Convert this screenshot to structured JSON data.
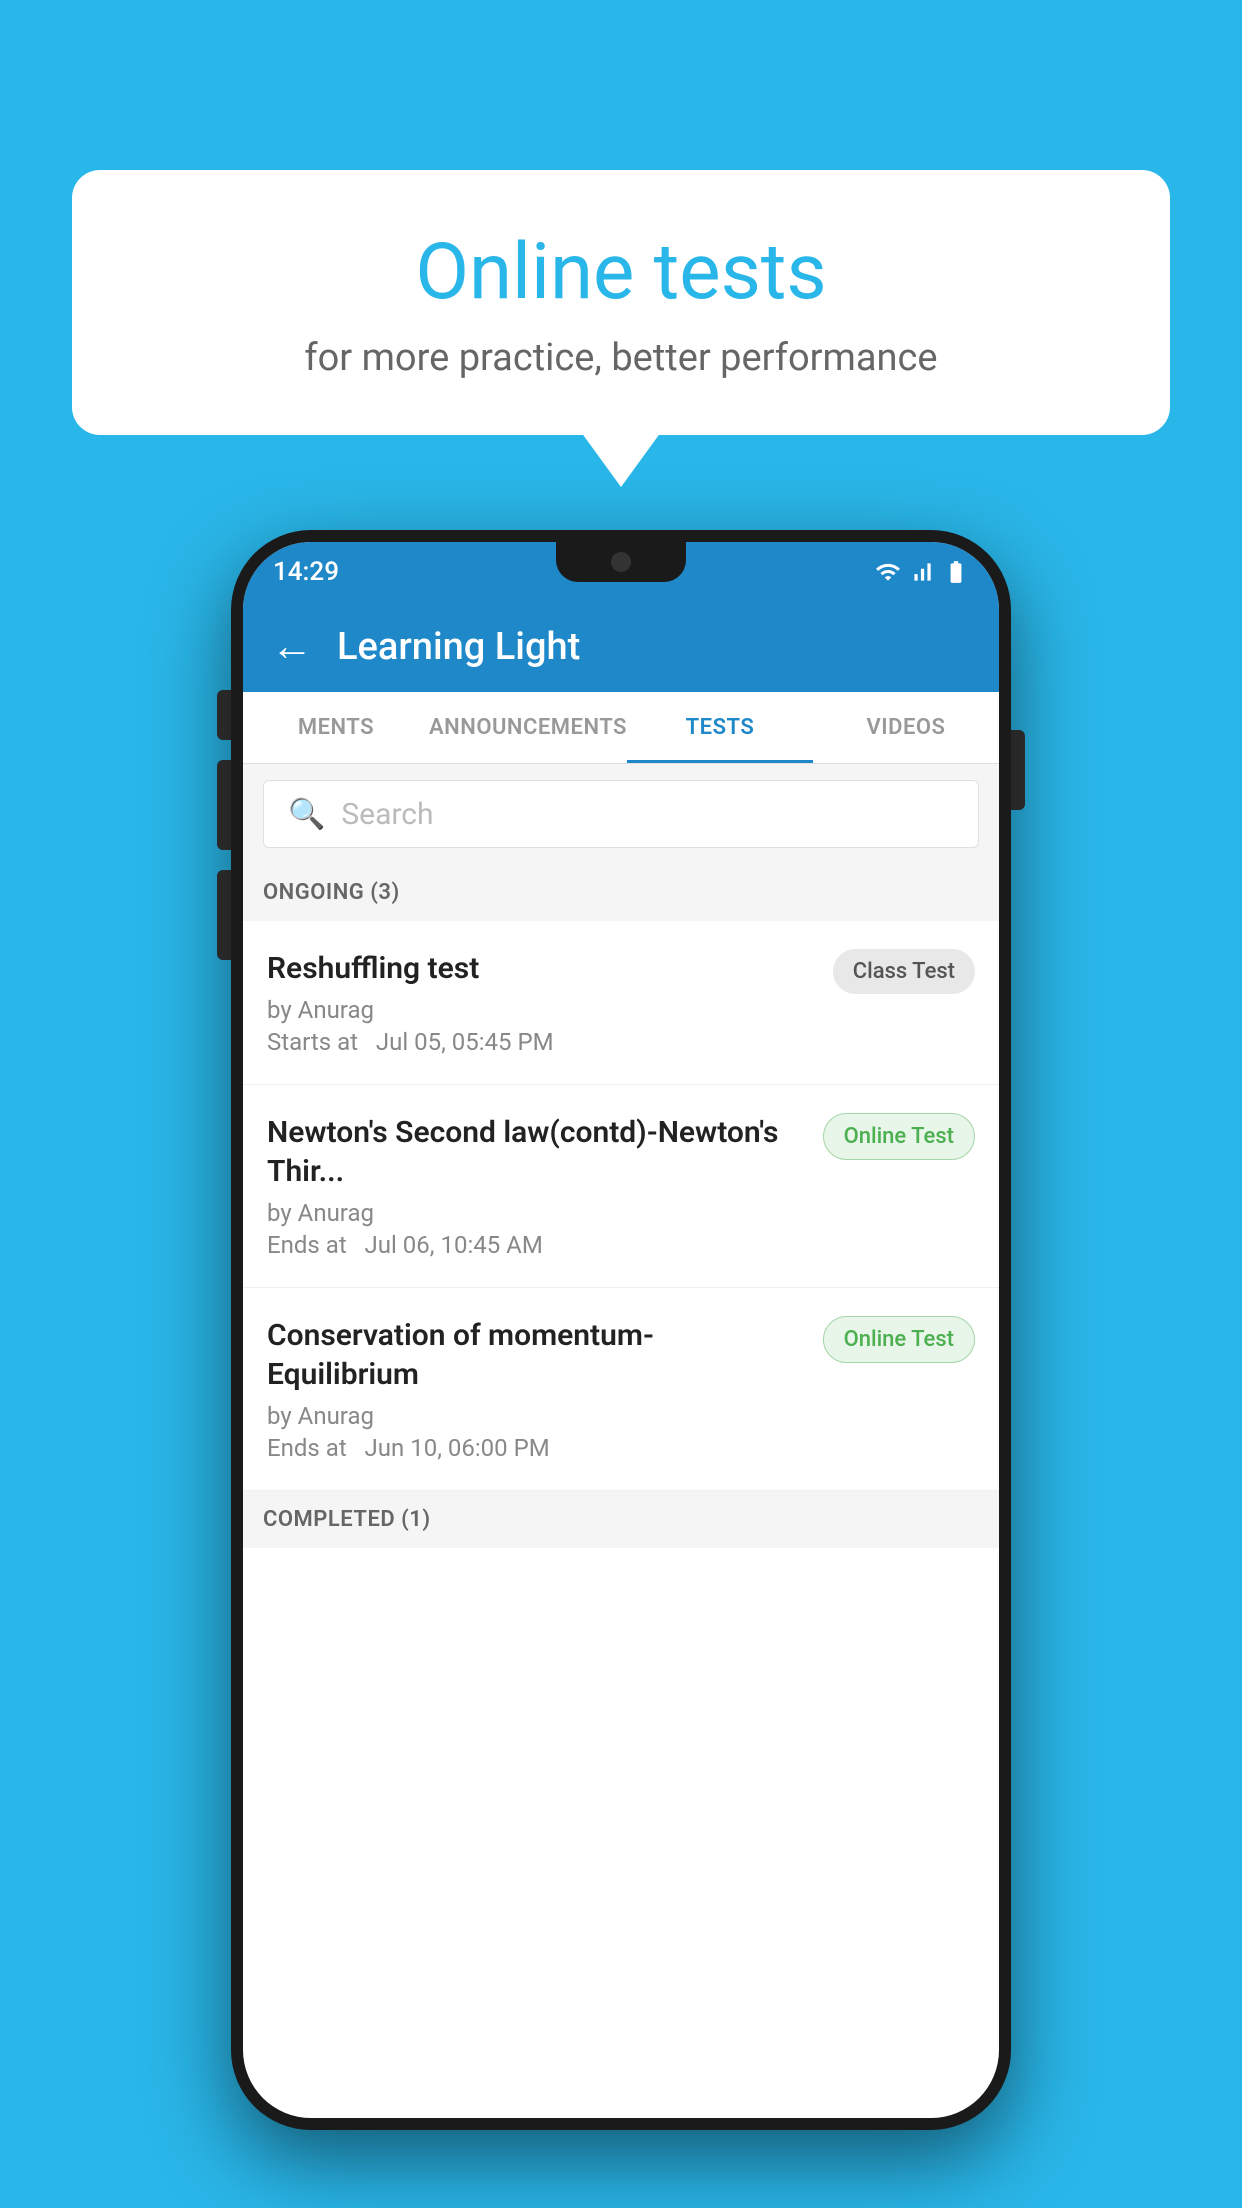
{
  "background_color": "#29b6e8",
  "speech_bubble": {
    "title": "Online tests",
    "subtitle": "for more practice, better performance"
  },
  "status_bar": {
    "time": "14:29"
  },
  "app_bar": {
    "back_icon": "←",
    "title": "Learning Light"
  },
  "tabs": [
    {
      "label": "MENTS",
      "active": false
    },
    {
      "label": "ANNOUNCEMENTS",
      "active": false
    },
    {
      "label": "TESTS",
      "active": true
    },
    {
      "label": "VIDEOS",
      "active": false
    }
  ],
  "search": {
    "placeholder": "Search"
  },
  "ongoing_section": {
    "label": "ONGOING (3)"
  },
  "tests": [
    {
      "name": "Reshuffling test",
      "author": "by Anurag",
      "time_label": "Starts at",
      "time": "Jul 05, 05:45 PM",
      "badge": "Class Test",
      "badge_type": "class"
    },
    {
      "name": "Newton's Second law(contd)-Newton's Thir...",
      "author": "by Anurag",
      "time_label": "Ends at",
      "time": "Jul 06, 10:45 AM",
      "badge": "Online Test",
      "badge_type": "online"
    },
    {
      "name": "Conservation of momentum-Equilibrium",
      "author": "by Anurag",
      "time_label": "Ends at",
      "time": "Jun 10, 06:00 PM",
      "badge": "Online Test",
      "badge_type": "online"
    }
  ],
  "completed_section": {
    "label": "COMPLETED (1)"
  }
}
